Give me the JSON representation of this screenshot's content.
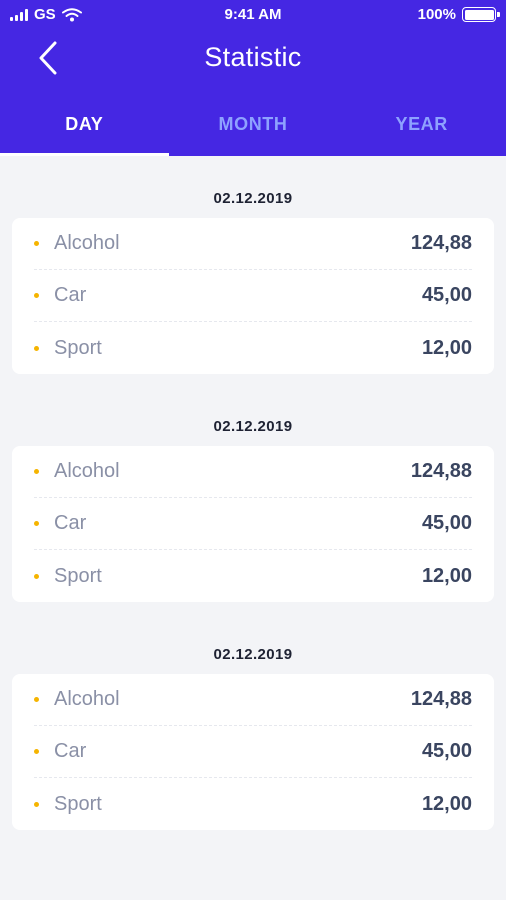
{
  "status_bar": {
    "carrier": "GS",
    "time": "9:41 AM",
    "battery": "100%"
  },
  "header": {
    "title": "Statistic",
    "tabs": [
      {
        "label": "DAY",
        "active": true
      },
      {
        "label": "MONTH",
        "active": false
      },
      {
        "label": "YEAR",
        "active": false
      }
    ]
  },
  "colors": {
    "header_bg": "#4527e3",
    "tab_inactive": "#8ea2ff",
    "bullet": "#f5b400"
  },
  "groups": [
    {
      "date": "02.12.2019",
      "items": [
        {
          "category": "Alcohol",
          "amount": "124,88"
        },
        {
          "category": "Car",
          "amount": "45,00"
        },
        {
          "category": "Sport",
          "amount": "12,00"
        }
      ]
    },
    {
      "date": "02.12.2019",
      "items": [
        {
          "category": "Alcohol",
          "amount": "124,88"
        },
        {
          "category": "Car",
          "amount": "45,00"
        },
        {
          "category": "Sport",
          "amount": "12,00"
        }
      ]
    },
    {
      "date": "02.12.2019",
      "items": [
        {
          "category": "Alcohol",
          "amount": "124,88"
        },
        {
          "category": "Car",
          "amount": "45,00"
        },
        {
          "category": "Sport",
          "amount": "12,00"
        }
      ]
    }
  ]
}
